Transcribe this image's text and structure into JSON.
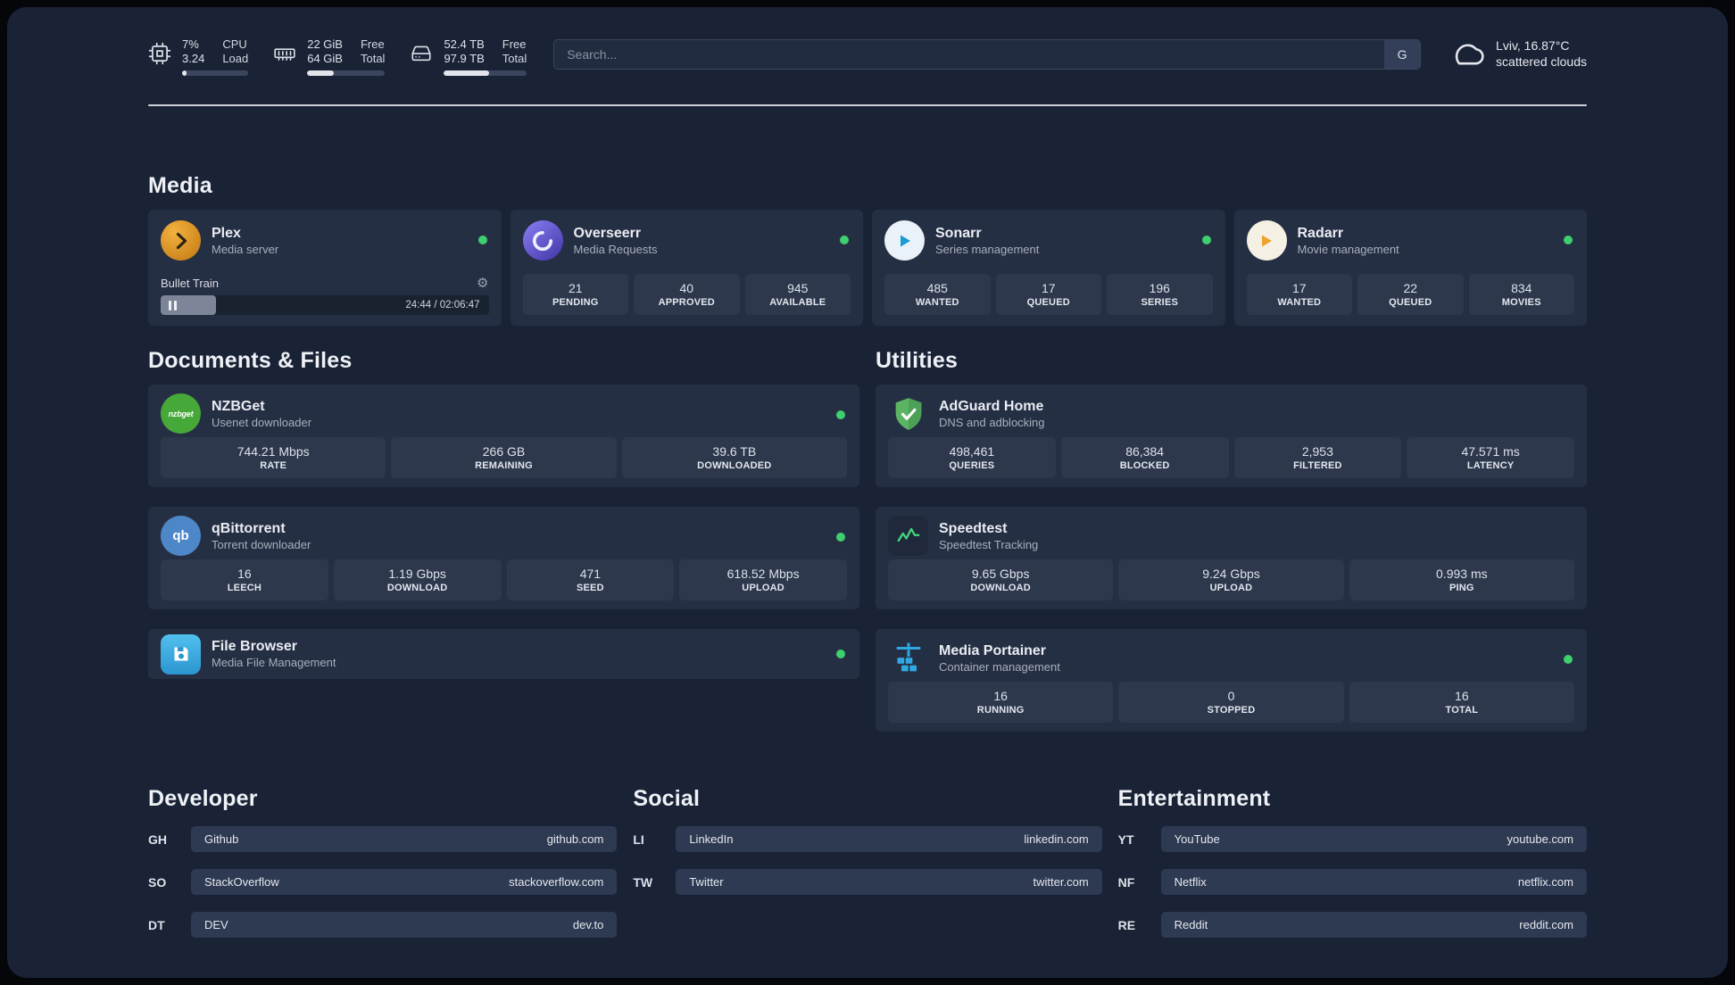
{
  "header": {
    "cpu": {
      "value_top": "7%",
      "label_top": "CPU",
      "value_bottom": "3.24",
      "label_bottom": "Load",
      "bar_percent": 7
    },
    "ram": {
      "value_top": "22 GiB",
      "label_top": "Free",
      "value_bottom": "64 GiB",
      "label_bottom": "Total",
      "bar_percent": 34
    },
    "disk": {
      "value_top": "52.4 TB",
      "label_top": "Free",
      "value_bottom": "97.9 TB",
      "label_bottom": "Total",
      "bar_percent": 54
    },
    "search": {
      "placeholder": "Search...",
      "button_label": "G"
    },
    "weather": {
      "location": "Lviv, 16.87°C",
      "condition": "scattered clouds"
    }
  },
  "sections": {
    "media": {
      "title": "Media"
    },
    "documents": {
      "title": "Documents & Files"
    },
    "utilities": {
      "title": "Utilities"
    },
    "developer": {
      "title": "Developer"
    },
    "social": {
      "title": "Social"
    },
    "entertainment": {
      "title": "Entertainment"
    }
  },
  "apps": {
    "plex": {
      "name": "Plex",
      "subtitle": "Media server",
      "status": "online",
      "player": {
        "track": "Bullet Train",
        "time": "24:44 / 02:06:47",
        "progress_percent": 17
      }
    },
    "overseerr": {
      "name": "Overseerr",
      "subtitle": "Media Requests",
      "status": "online",
      "stats": [
        {
          "value": "21",
          "label": "PENDING"
        },
        {
          "value": "40",
          "label": "APPROVED"
        },
        {
          "value": "945",
          "label": "AVAILABLE"
        }
      ]
    },
    "sonarr": {
      "name": "Sonarr",
      "subtitle": "Series management",
      "status": "online",
      "stats": [
        {
          "value": "485",
          "label": "WANTED"
        },
        {
          "value": "17",
          "label": "QUEUED"
        },
        {
          "value": "196",
          "label": "SERIES"
        }
      ]
    },
    "radarr": {
      "name": "Radarr",
      "subtitle": "Movie management",
      "status": "online",
      "stats": [
        {
          "value": "17",
          "label": "WANTED"
        },
        {
          "value": "22",
          "label": "QUEUED"
        },
        {
          "value": "834",
          "label": "MOVIES"
        }
      ]
    },
    "nzbget": {
      "name": "NZBGet",
      "subtitle": "Usenet downloader",
      "status": "online",
      "stats": [
        {
          "value": "744.21 Mbps",
          "label": "RATE"
        },
        {
          "value": "266 GB",
          "label": "REMAINING"
        },
        {
          "value": "39.6 TB",
          "label": "DOWNLOADED"
        }
      ]
    },
    "qbittorrent": {
      "name": "qBittorrent",
      "subtitle": "Torrent downloader",
      "status": "online",
      "stats": [
        {
          "value": "16",
          "label": "LEECH"
        },
        {
          "value": "1.19 Gbps",
          "label": "DOWNLOAD"
        },
        {
          "value": "471",
          "label": "SEED"
        },
        {
          "value": "618.52 Mbps",
          "label": "UPLOAD"
        }
      ]
    },
    "filebrowser": {
      "name": "File Browser",
      "subtitle": "Media File Management",
      "status": "online"
    },
    "adguard": {
      "name": "AdGuard Home",
      "subtitle": "DNS and adblocking",
      "stats": [
        {
          "value": "498,461",
          "label": "QUERIES"
        },
        {
          "value": "86,384",
          "label": "BLOCKED"
        },
        {
          "value": "2,953",
          "label": "FILTERED"
        },
        {
          "value": "47.571 ms",
          "label": "LATENCY"
        }
      ]
    },
    "speedtest": {
      "name": "Speedtest",
      "subtitle": "Speedtest Tracking",
      "stats": [
        {
          "value": "9.65 Gbps",
          "label": "DOWNLOAD"
        },
        {
          "value": "9.24 Gbps",
          "label": "UPLOAD"
        },
        {
          "value": "0.993 ms",
          "label": "PING"
        }
      ]
    },
    "portainer": {
      "name": "Media Portainer",
      "subtitle": "Container management",
      "status": "online",
      "stats": [
        {
          "value": "16",
          "label": "RUNNING"
        },
        {
          "value": "0",
          "label": "STOPPED"
        },
        {
          "value": "16",
          "label": "TOTAL"
        }
      ]
    }
  },
  "bookmarks": {
    "developer": [
      {
        "abbr": "GH",
        "name": "Github",
        "url": "github.com"
      },
      {
        "abbr": "SO",
        "name": "StackOverflow",
        "url": "stackoverflow.com"
      },
      {
        "abbr": "DT",
        "name": "DEV",
        "url": "dev.to"
      }
    ],
    "social": [
      {
        "abbr": "LI",
        "name": "LinkedIn",
        "url": "linkedin.com"
      },
      {
        "abbr": "TW",
        "name": "Twitter",
        "url": "twitter.com"
      }
    ],
    "entertainment": [
      {
        "abbr": "YT",
        "name": "YouTube",
        "url": "youtube.com"
      },
      {
        "abbr": "NF",
        "name": "Netflix",
        "url": "netflix.com"
      },
      {
        "abbr": "RE",
        "name": "Reddit",
        "url": "reddit.com"
      }
    ]
  }
}
